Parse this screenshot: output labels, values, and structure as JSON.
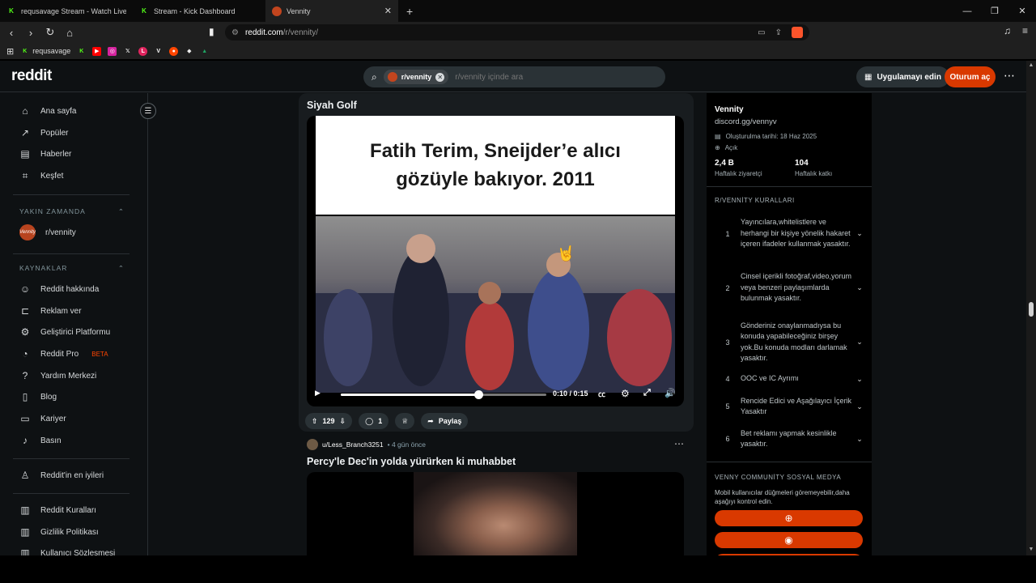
{
  "browser": {
    "tabs": [
      {
        "title": "requsavage Stream - Watch Live on Kick",
        "favicon": "kick-icon",
        "color": "#53fc18"
      },
      {
        "title": "Stream - Kick Dashboard",
        "favicon": "kick-icon",
        "color": "#53fc18"
      },
      {
        "title": "Vennity",
        "favicon": "vennity-icon",
        "color": "#c2451e",
        "active": true
      }
    ],
    "url_host": "reddit.com",
    "url_path": "/r/vennity/",
    "bookmarks": [
      {
        "label": "requsavage",
        "icon": "kick-icon",
        "color": "#53fc18"
      },
      {
        "label": "",
        "icon": "kick-icon",
        "color": "#53fc18"
      },
      {
        "label": "",
        "icon": "youtube-icon",
        "color": "#ff0000"
      },
      {
        "label": "",
        "icon": "instagram-icon",
        "color": "#d6249f"
      },
      {
        "label": "",
        "icon": "x-icon",
        "color": "#1f1f1f"
      },
      {
        "label": "",
        "icon": "letterboxd-icon",
        "color": "#e0245e"
      },
      {
        "label": "",
        "icon": "v-icon",
        "color": "#1f1f1f"
      },
      {
        "label": "",
        "icon": "reddit-icon",
        "color": "#ff4500"
      },
      {
        "label": "",
        "icon": "diamond-icon",
        "color": "#eeeeee"
      },
      {
        "label": "",
        "icon": "drive-icon",
        "color": "#1fa463"
      }
    ]
  },
  "header": {
    "logo": "reddit",
    "search_chip": "r/vennity",
    "search_placeholder": "r/vennity içinde ara",
    "get_app": "Uygulamayı edin",
    "login": "Oturum aç"
  },
  "sidebar": {
    "main": [
      {
        "label": "Ana sayfa",
        "icon": "home-icon"
      },
      {
        "label": "Popüler",
        "icon": "popular-icon"
      },
      {
        "label": "Haberler",
        "icon": "news-icon"
      },
      {
        "label": "Keşfet",
        "icon": "explore-icon"
      }
    ],
    "recent_heading": "YAKIN ZAMANDA",
    "recent": [
      {
        "label": "r/vennity",
        "avatar_text": "Vennity"
      }
    ],
    "resources_heading": "KAYNAKLAR",
    "resources": [
      {
        "label": "Reddit hakkında",
        "icon": "reddit-icon"
      },
      {
        "label": "Reklam ver",
        "icon": "megaphone-icon"
      },
      {
        "label": "Geliştirici Platformu",
        "icon": "code-icon"
      },
      {
        "label": "Reddit Pro",
        "icon": "pro-icon",
        "badge": "BETA"
      },
      {
        "label": "Yardım Merkezi",
        "icon": "help-icon"
      },
      {
        "label": "Blog",
        "icon": "book-icon"
      },
      {
        "label": "Kariyer",
        "icon": "briefcase-icon"
      },
      {
        "label": "Basın",
        "icon": "microphone-icon"
      }
    ],
    "best": {
      "label": "Reddit'in en iyileri",
      "icon": "best-icon"
    },
    "legal": [
      {
        "label": "Reddit Kuralları",
        "icon": "rules-icon"
      },
      {
        "label": "Gizlilik Politikası",
        "icon": "privacy-icon"
      },
      {
        "label": "Kullanıcı Sözleşmesi",
        "icon": "agreement-icon"
      }
    ]
  },
  "post1": {
    "title": "Siyah Golf",
    "video_caption_line1": "Fatih Terim, Sneijder’e alıcı",
    "video_caption_line2": "gözüyle bakıyor. 2011",
    "time": "0:10 / 0:15",
    "progress_fraction": 0.67,
    "votes": "129",
    "comments": "1",
    "share": "Paylaş"
  },
  "post2": {
    "author": "u/Less_Branch3251",
    "age": "• 4 gün önce",
    "title": "Percy'le Dec'in yolda yürürken ki muhabbet"
  },
  "community": {
    "name": "Vennity",
    "link": "discord.gg/vennyv",
    "created": "Oluşturulma tarihi: 18 Haz 2025",
    "visibility": "Açık",
    "stat1_value": "2,4 B",
    "stat1_label": "Haftalık ziyaretçi",
    "stat2_value": "104",
    "stat2_label": "Haftalık katkı",
    "rules_heading": "R/VENNİTY KURALLARI",
    "rules": [
      {
        "num": "1",
        "text": "Yayıncılara,whitelistlere ve herhangi bir kişiye yönelik hakaret içeren ifadeler kullanmak yasaktır."
      },
      {
        "num": "2",
        "text": "Cinsel içerikli fotoğraf,video,yorum veya benzeri paylaşımlarda bulunmak yasaktır."
      },
      {
        "num": "3",
        "text": "Gönderiniz onaylanmadıysa bu konuda yapabileceğiniz birşey yok.Bu konuda modları darlamak yasaktır."
      },
      {
        "num": "4",
        "text": "OOC ve IC Ayrımı"
      },
      {
        "num": "5",
        "text": "Rencide Edici ve Aşağılayıcı İçerik Yasaktır"
      },
      {
        "num": "6",
        "text": "Bet reklamı yapmak kesinlikle yasaktır."
      }
    ],
    "social_heading": "VENNY COMMUNİTY SOSYAL MEDYA",
    "social_note": "Mobil kullanıcılar düğmeleri göremeyebilir,daha aşağıyı kontrol edin."
  }
}
